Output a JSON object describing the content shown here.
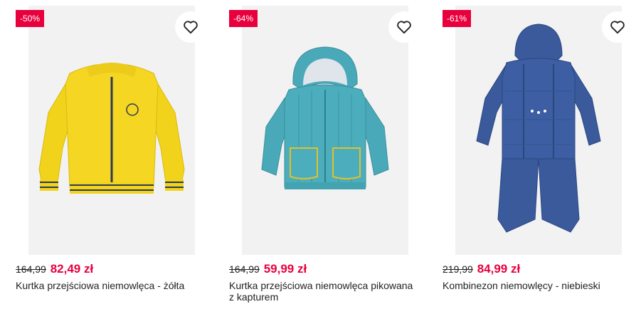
{
  "products": [
    {
      "badge": "-50%",
      "old_price": "164,99",
      "new_price": "82,49 zł",
      "title": "Kurtka przejściowa niemowlęca - żółta",
      "color": "#f2d31b",
      "accent": "#2e3a55"
    },
    {
      "badge": "-64%",
      "old_price": "164,99",
      "new_price": "59,99 zł",
      "title": "Kurtka przejściowa niemowlęca pikowana z kapturem",
      "color": "#4aa9b8",
      "accent": "#e2c12a"
    },
    {
      "badge": "-61%",
      "old_price": "219,99",
      "new_price": "84,99 zł",
      "title": "Kombinezon niemowlęcy - niebieski",
      "color": "#3a5a9c",
      "accent": "#ffffff"
    }
  ],
  "colors": {
    "sale": "#e8003d",
    "image_bg": "#f2f2f2"
  },
  "icons": {
    "favorite": "heart-icon"
  }
}
